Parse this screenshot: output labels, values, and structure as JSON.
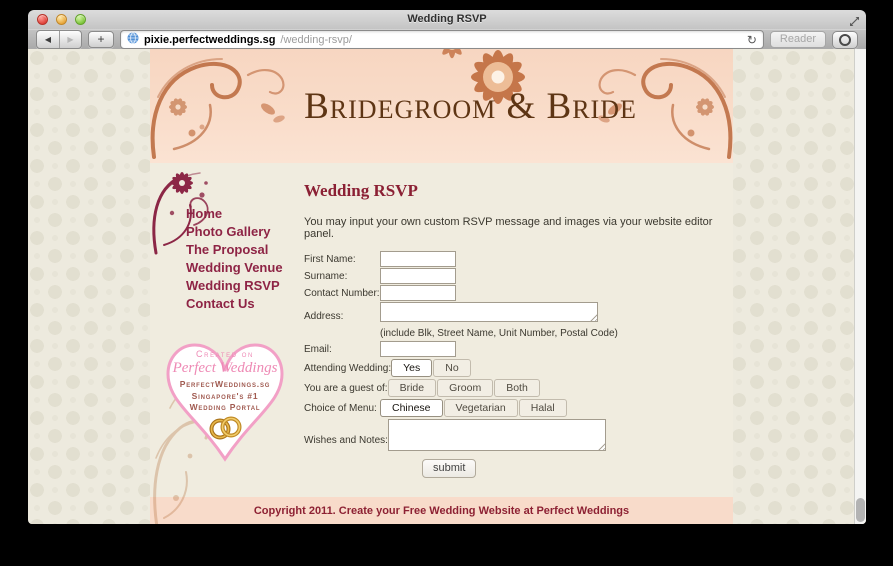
{
  "window": {
    "title": "Wedding RSVP",
    "toolbar": {
      "back_icon": "◀",
      "forward_icon": "▶",
      "new_tab_icon": "+",
      "refresh_icon": "↻",
      "reader_label": "Reader",
      "url_host": "pixie.perfectweddings.sg",
      "url_path": "/wedding-rsvp/"
    }
  },
  "site": {
    "header_title": "Bridegroom & Bride",
    "nav": [
      "Home",
      "Photo Gallery",
      "The Proposal",
      "Wedding Venue",
      "Wedding RSVP",
      "Contact Us"
    ],
    "badge": {
      "created_on": "Created on",
      "brand_script": "Perfect Weddings",
      "domain": "PerfectWeddings.sg",
      "tagline1": "Singapore's #1",
      "tagline2": "Wedding Portal"
    },
    "footer_text": "Copyright 2011. Create your Free Wedding Website at Perfect Weddings"
  },
  "rsvp": {
    "heading": "Wedding RSVP",
    "intro": "You may input your own custom RSVP message and images via your website editor panel.",
    "labels": {
      "first_name": "First Name:",
      "surname": "Surname:",
      "contact_number": "Contact Number:",
      "address": "Address:",
      "address_hint": "(include Blk, Street Name, Unit Number, Postal Code)",
      "email": "Email:",
      "attending": "Attending Wedding:",
      "guest_of": "You are a guest of:",
      "menu": "Choice of Menu:",
      "wishes": "Wishes and Notes:"
    },
    "options": {
      "attending": [
        "Yes",
        "No"
      ],
      "attending_selected": "Yes",
      "guest_of": [
        "Bride",
        "Groom",
        "Both"
      ],
      "guest_of_selected": "",
      "menu": [
        "Chinese",
        "Vegetarian",
        "Halal"
      ],
      "menu_selected": "Chinese"
    },
    "field_values": {
      "first_name": "",
      "surname": "",
      "contact_number": "",
      "address": "",
      "email": "",
      "wishes": ""
    },
    "submit_label": "submit"
  },
  "colors": {
    "header_pink": "#f8dac6",
    "footer_pink": "#f8dbca",
    "content_cream": "#f0ecdf",
    "nav_maroon": "#8e2445",
    "heading_maroon": "#8b2034",
    "title_brown": "#5e3514",
    "floral_terracotta": "#c4784e",
    "badge_pink": "#ee8ab5",
    "badge_brown": "#a05a50"
  }
}
